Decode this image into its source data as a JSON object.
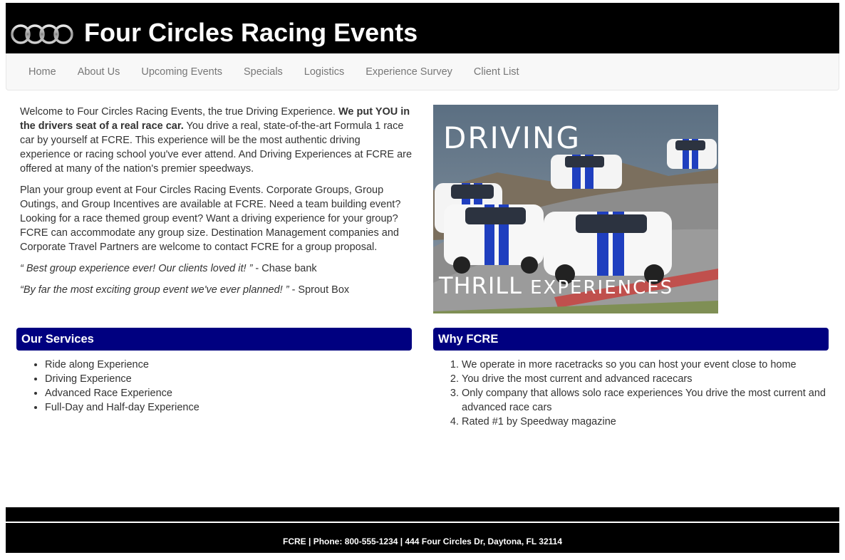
{
  "header": {
    "title": "Four Circles Racing Events",
    "logo_icon": "four-rings-logo"
  },
  "nav": {
    "items": [
      "Home",
      "About Us",
      "Upcoming Events",
      "Specials",
      "Logistics",
      "Experience Survey",
      "Client List"
    ]
  },
  "intro": {
    "p1_start": "Welcome to Four Circles Racing Events, the true Driving Experience. ",
    "p1_bold": "We put YOU in the drivers seat of a real race car.",
    "p1_end": " You drive a real, state-of-the-art Formula 1 race car by yourself at FCRE. This experience will be the most authentic driving experience or racing school you've ever attend. And Driving Experiences at FCRE are offered at many of the nation's premier speedways.",
    "p2": "Plan your group event at Four Circles Racing Events. Corporate Groups, Group Outings, and Group Incentives are available at FCRE. Need a team building event? Looking for a race themed group event? Want a driving experience for your group? FCRE can accommodate any group size. Destination Management companies and Corporate Travel Partners are welcome to contact FCRE for a group proposal.",
    "quote1": "“ Best group experience ever! Our clients loved it! ”",
    "quote1_source": " - Chase bank",
    "quote2": "“By far the most exciting group event we've ever planned! ”",
    "quote2_source": " - Sprout Box"
  },
  "hero": {
    "word1": "DRIVING",
    "word2": "THRILL",
    "word3": "EXPERIENCES"
  },
  "services": {
    "heading": "Our Services",
    "items": [
      "Ride along Experience",
      "Driving Experience",
      "Advanced Race Experience",
      "Full-Day and Half-day Experience"
    ]
  },
  "why": {
    "heading": "Why FCRE",
    "items": [
      "We operate in more racetracks so you can host your event close to home",
      "You drive the most current and advanced racecars",
      "Only company that allows solo race experiences You drive the most current and advanced race cars",
      "Rated #1 by Speedway magazine"
    ]
  },
  "footer": {
    "text": "FCRE | Phone: 800-555-1234 | 444 Four Circles Dr, Daytona, FL 32114"
  },
  "colors": {
    "header_bg": "#000000",
    "panel_heading_bg": "#000080",
    "nav_bg": "#f8f8f8",
    "nav_text": "#777777"
  }
}
